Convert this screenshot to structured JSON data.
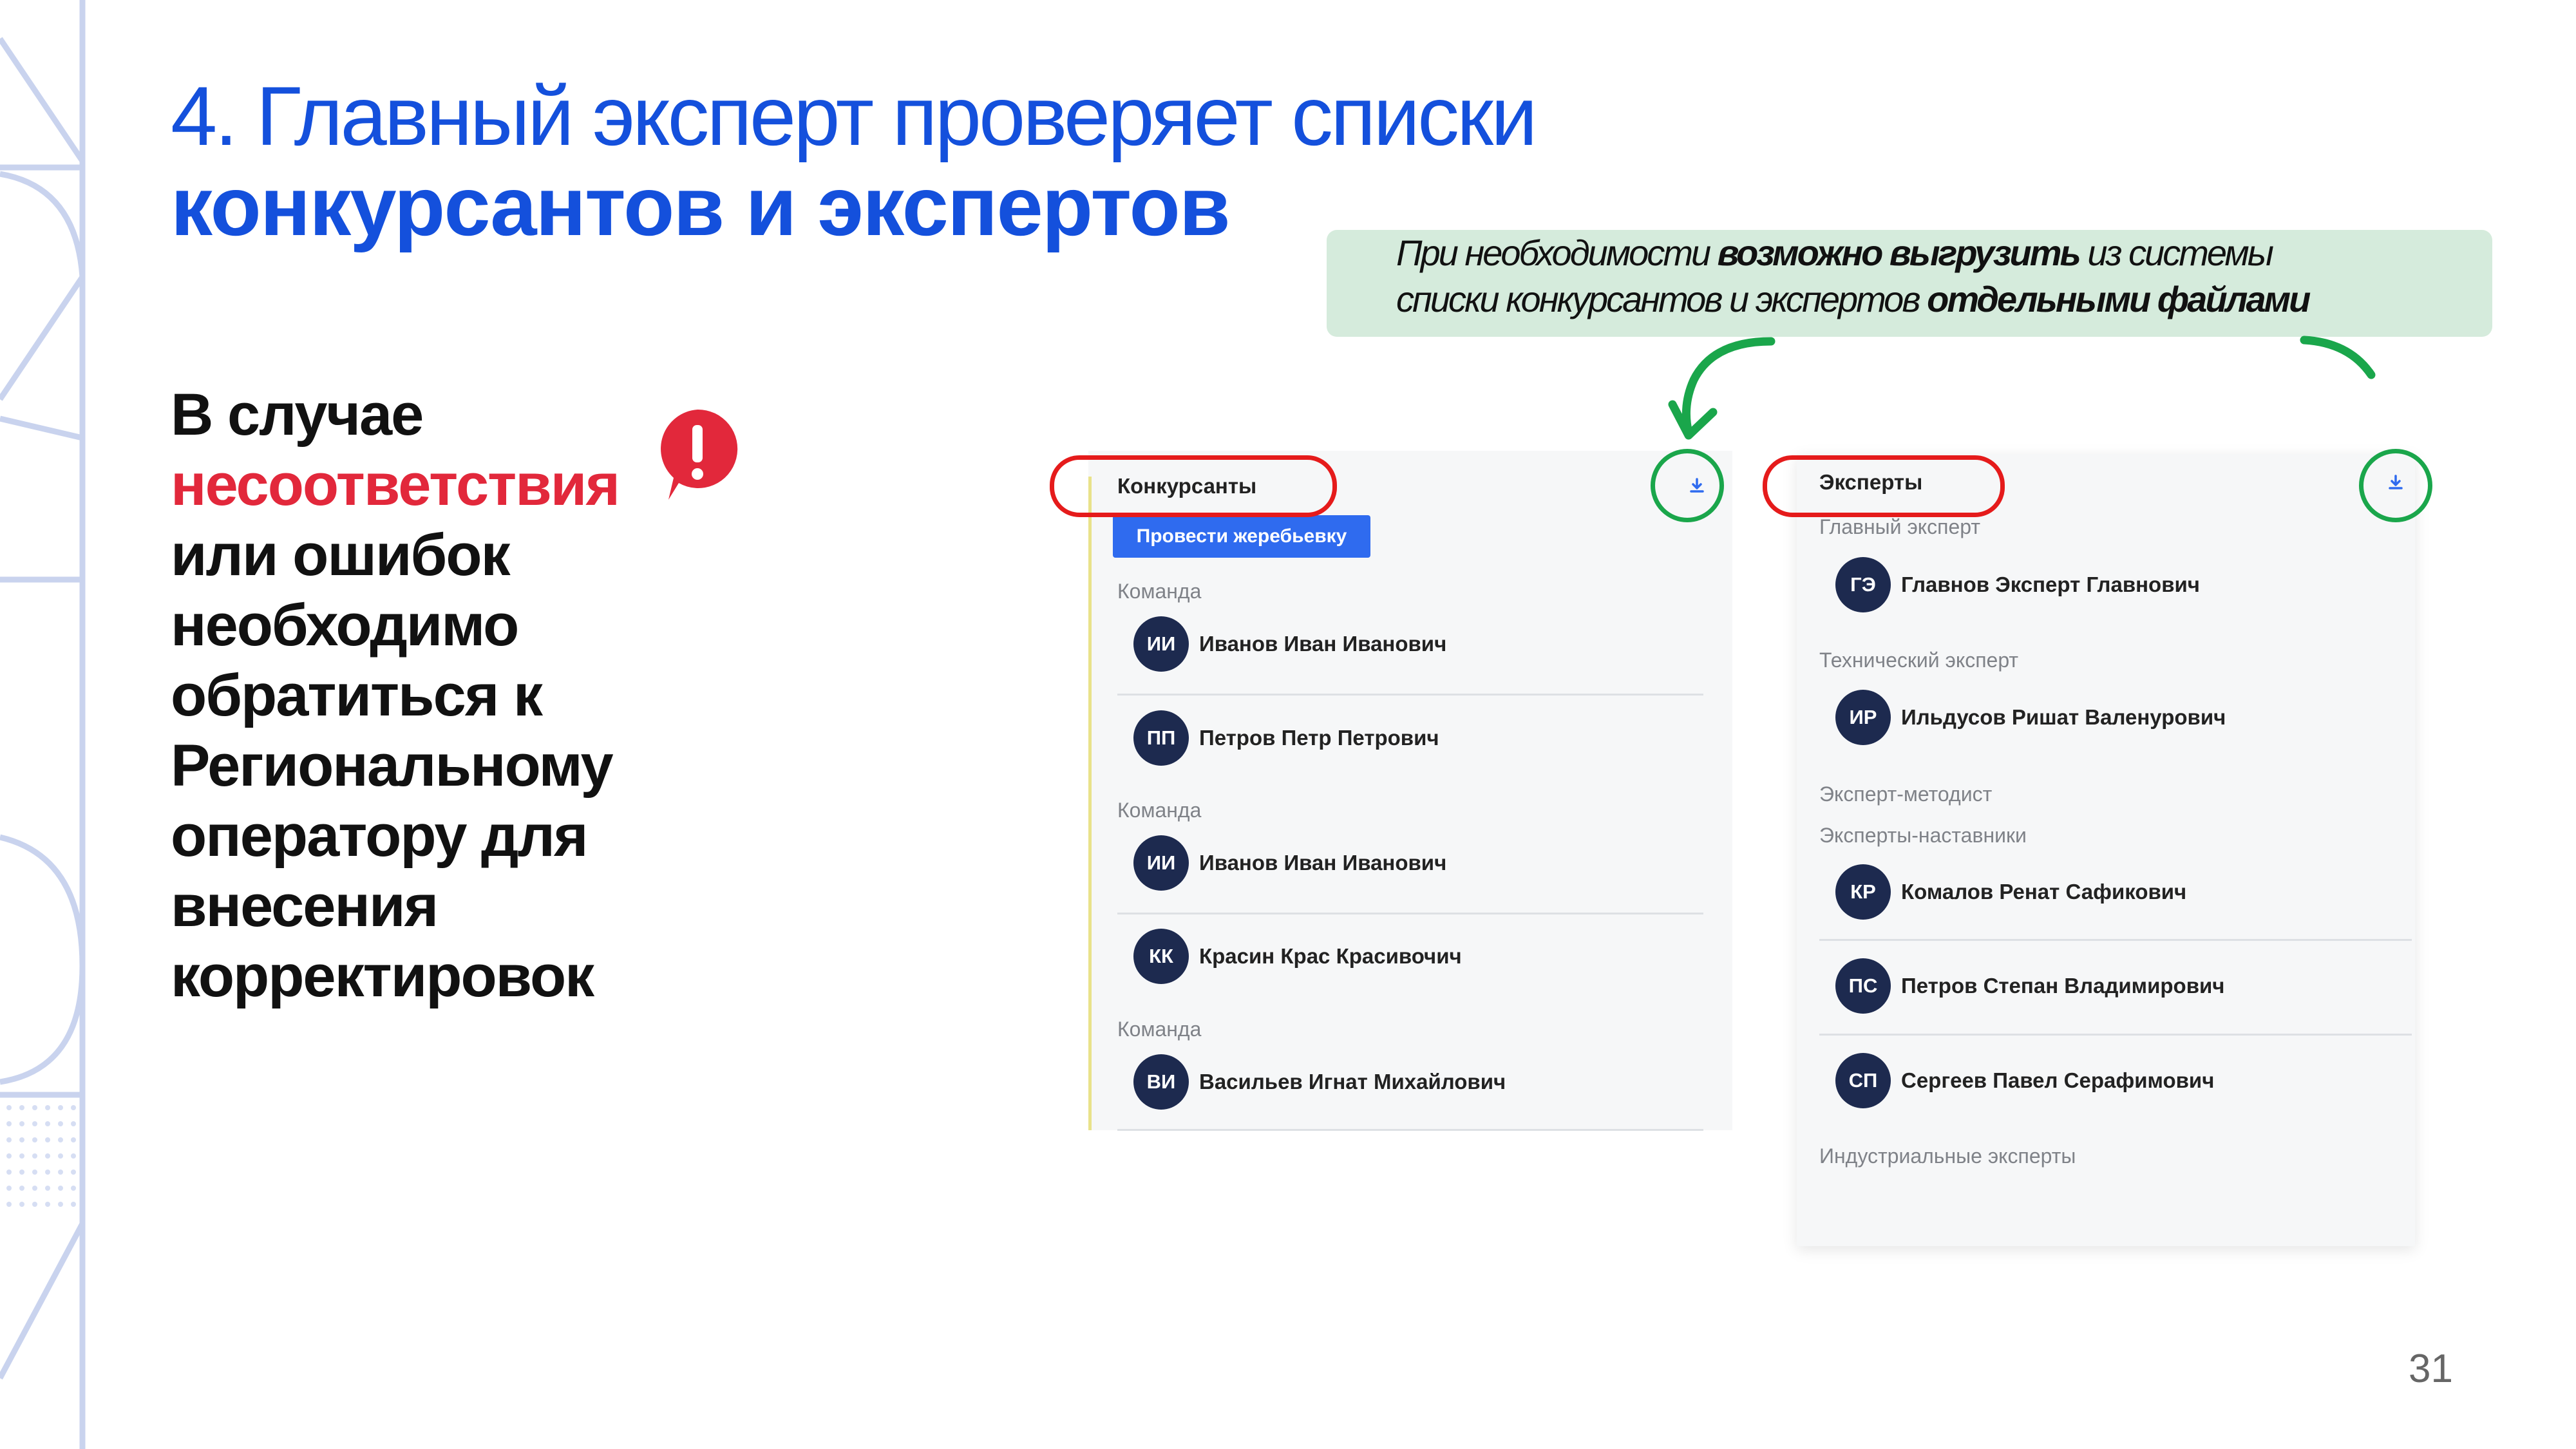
{
  "slide": {
    "title_line1": "4. Главный эксперт проверяет списки",
    "title_line2": "конкурсантов и экспертов",
    "page_number": "31"
  },
  "note": {
    "line1_pre": "При необходимости ",
    "line1_bold": "возможно выгрузить",
    "line1_post": " из системы",
    "line2_pre": "списки конкурсантов и экспертов ",
    "line2_bold": "отдельными файлами"
  },
  "lead": {
    "l1": "В случае",
    "l2": "несоответствия",
    "l3": "или ошибок",
    "l4": "необходимо",
    "l5": "обратиться к",
    "l6": "Региональному",
    "l7": "оператору для",
    "l8": "внесения",
    "l9": "корректировок"
  },
  "alert_icon": "exclamation-icon",
  "contestants": {
    "title": "Конкурсанты",
    "draw_button": "Провести жеребьевку",
    "download_icon": "download-icon",
    "teams": [
      {
        "label": "Команда",
        "members": [
          {
            "initials": "ИИ",
            "name": "Иванов Иван Иванович"
          },
          {
            "initials": "ПП",
            "name": "Петров Петр Петрович"
          }
        ]
      },
      {
        "label": "Команда",
        "members": [
          {
            "initials": "ИИ",
            "name": "Иванов Иван Иванович"
          },
          {
            "initials": "КК",
            "name": "Красин Крас Красивочич"
          }
        ]
      },
      {
        "label": "Команда",
        "members": [
          {
            "initials": "ВИ",
            "name": "Васильев Игнат Михайлович"
          }
        ]
      }
    ]
  },
  "experts": {
    "title": "Эксперты",
    "download_icon": "download-icon",
    "chief_label": "Главный эксперт",
    "chief": {
      "initials": "ГЭ",
      "name": "Главнов Эксперт Главнович"
    },
    "tech_label": "Технический эксперт",
    "tech": {
      "initials": "ИР",
      "name": "Ильдусов Ришат Валенурович"
    },
    "methodist_label": "Эксперт-методист",
    "mentors_label": "Эксперты-наставники",
    "mentors": [
      {
        "initials": "КР",
        "name": "Комалов Ренат Сафикович"
      },
      {
        "initials": "ПС",
        "name": "Петров Степан Владимирович"
      },
      {
        "initials": "СП",
        "name": "Сергеев Павел Серафимович"
      }
    ],
    "industrial_label": "Индустриальные эксперты"
  },
  "colors": {
    "accent_blue": "#1450dc",
    "warning_red": "#e2283b",
    "highlight_green": "#1aa64b",
    "note_bg": "#d5ebdc",
    "avatar": "#1d2a4f"
  }
}
